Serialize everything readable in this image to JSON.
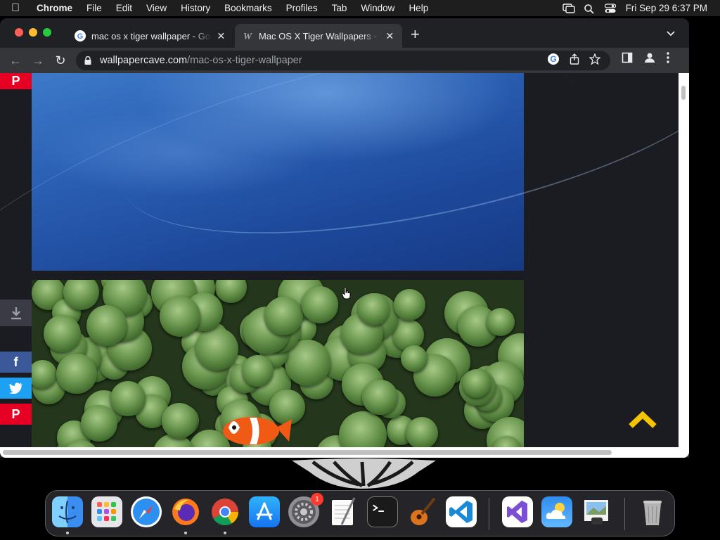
{
  "menubar": {
    "app_name": "Chrome",
    "items": [
      "File",
      "Edit",
      "View",
      "History",
      "Bookmarks",
      "Profiles",
      "Tab",
      "Window",
      "Help"
    ],
    "clock": "Fri Sep 29  6:37 PM"
  },
  "tabs": [
    {
      "title": "mac os x tiger wallpaper - Google Search",
      "favicon": "google-icon",
      "active": false
    },
    {
      "title": "Mac OS X Tiger Wallpapers - Wallpaper Cave",
      "favicon": "wallpapercave-icon",
      "active": true
    }
  ],
  "address_bar": {
    "domain": "wallpapercave.com",
    "path": "/mac-os-x-tiger-wallpaper"
  },
  "page": {
    "images": [
      "blue-aqua-wallpaper",
      "anemone-clownfish-wallpaper"
    ],
    "social": [
      "pinterest",
      "download",
      "facebook",
      "twitter",
      "pinterest"
    ],
    "social_glyphs": {
      "facebook": "f",
      "pinterest": "P"
    },
    "colors": {
      "pinterest": "#e60023",
      "facebook": "#3b5998",
      "twitter": "#1da1f2",
      "download": "#3a3b44",
      "scroll_top": "#f5c400"
    }
  },
  "dock": {
    "apps": [
      "Finder",
      "Launchpad",
      "Safari",
      "Firefox",
      "Google Chrome",
      "App Store",
      "System Settings",
      "TextEdit",
      "Terminal",
      "GarageBand",
      "Visual Studio Code",
      "Visual Studio",
      "Weather",
      "Preview",
      "Trash"
    ],
    "system_settings_badge": "1"
  }
}
